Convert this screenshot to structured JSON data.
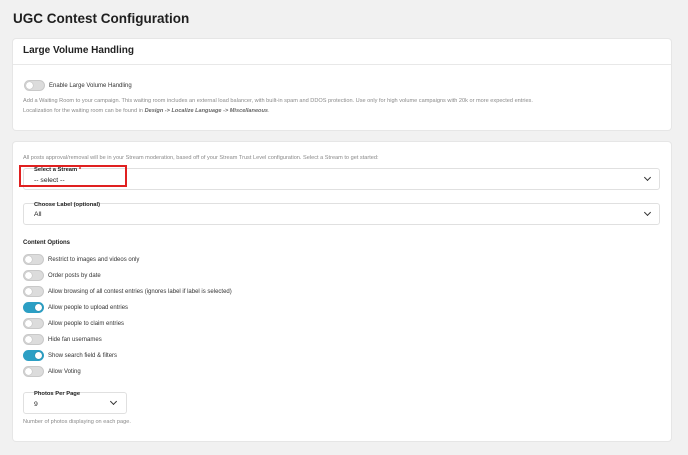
{
  "page": {
    "title": "UGC Contest Configuration"
  },
  "large_volume": {
    "heading": "Large Volume Handling",
    "toggle_label": "Enable Large Volume Handling",
    "toggle_on": false,
    "description_line1": "Add a Waiting Room to your campaign. This waiting room includes an external load balancer, with built-in spam and DDOS protection. Use only for high volume campaigns with 20k or more expected entries.",
    "description_line2_prefix": "Localization for the waiting room can be found in ",
    "description_line2_path": "Design -> Localize Language -> Miscellaneous",
    "description_line2_suffix": "."
  },
  "stream": {
    "intro": "All posts approval/removal will be in your Stream moderation, based off of your Stream Trust Level configuration. Select a Stream to get started:",
    "select_label": "Select a Stream",
    "required_mark": "*",
    "select_value": "-- select --"
  },
  "label": {
    "select_label": "Choose Label (optional)",
    "select_value": "All"
  },
  "content_options": {
    "heading": "Content Options",
    "items": [
      {
        "label": "Restrict to images and videos only",
        "on": false
      },
      {
        "label": "Order posts by date",
        "on": false
      },
      {
        "label": "Allow browsing of all contest entries (ignores label if label is selected)",
        "on": false
      },
      {
        "label": "Allow people to upload entries",
        "on": true
      },
      {
        "label": "Allow people to claim entries",
        "on": false
      },
      {
        "label": "Hide fan usernames",
        "on": false
      },
      {
        "label": "Show search field & filters",
        "on": true
      },
      {
        "label": "Allow Voting",
        "on": false
      }
    ]
  },
  "photos_per_page": {
    "select_label": "Photos Per Page",
    "select_value": "9",
    "help": "Number of photos displaying on each page."
  },
  "colors": {
    "toggle_on": "#2c9fc4",
    "highlight": "#e02020"
  }
}
